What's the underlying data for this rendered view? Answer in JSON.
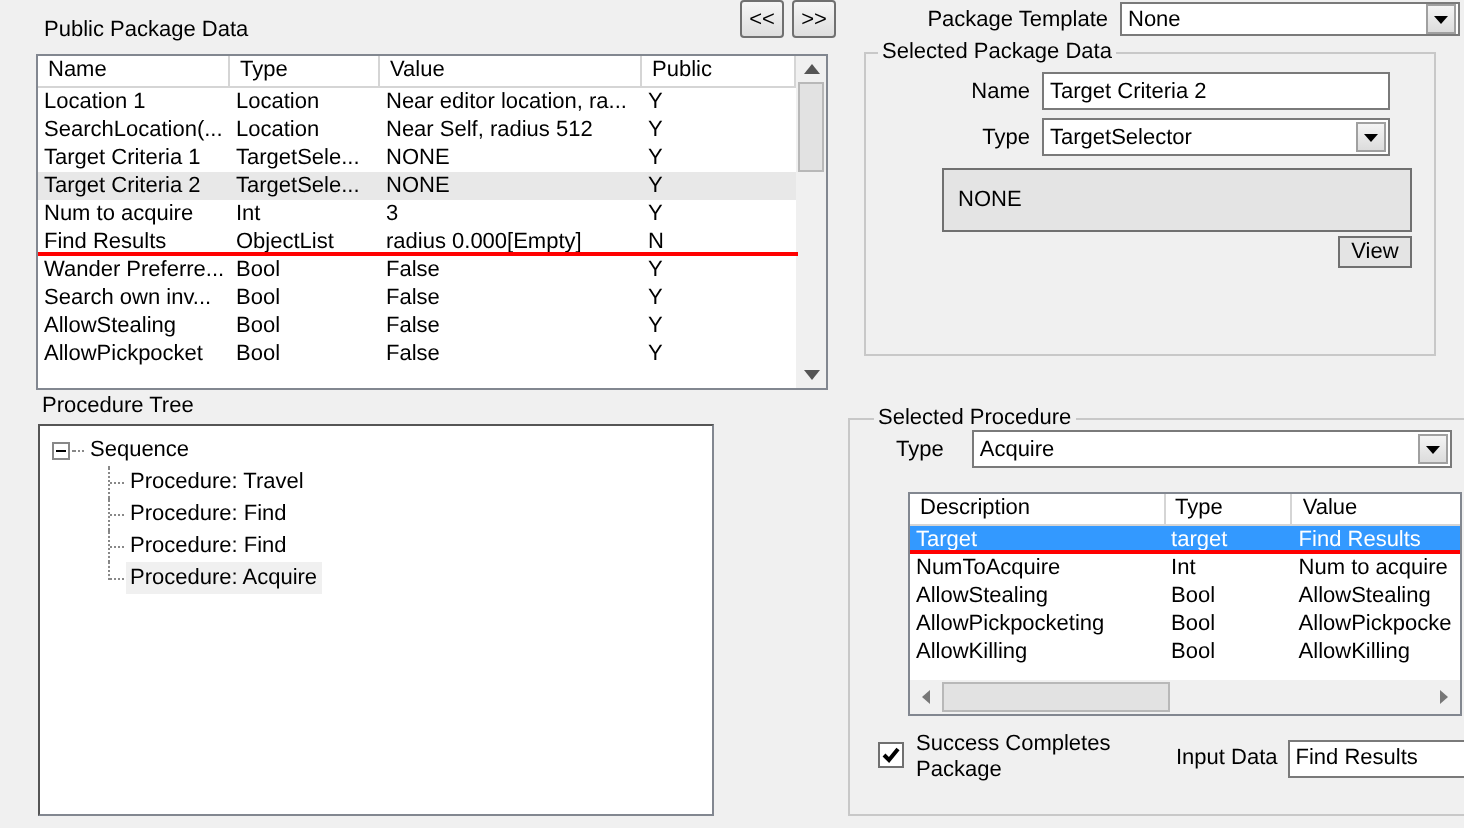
{
  "public_package_data": {
    "title": "Public Package Data",
    "nav_buttons": [
      "<<",
      ">>"
    ],
    "columns": [
      "Name",
      "Type",
      "Value",
      "Public"
    ],
    "rows": [
      {
        "cells": [
          "Location 1",
          "Location",
          "Near editor location, ra...",
          "Y"
        ],
        "selected": false,
        "underlined": false
      },
      {
        "cells": [
          "SearchLocation(...",
          "Location",
          "Near Self, radius 512",
          "Y"
        ],
        "selected": false,
        "underlined": false
      },
      {
        "cells": [
          "Target Criteria 1",
          "TargetSele...",
          "NONE",
          "Y"
        ],
        "selected": false,
        "underlined": false
      },
      {
        "cells": [
          "Target Criteria 2",
          "TargetSele...",
          "NONE",
          "Y"
        ],
        "selected": true,
        "underlined": false
      },
      {
        "cells": [
          "Num to acquire",
          "Int",
          "3",
          "Y"
        ],
        "selected": false,
        "underlined": false
      },
      {
        "cells": [
          "Find Results",
          "ObjectList",
          "radius 0.000[Empty]",
          "N"
        ],
        "selected": false,
        "underlined": true
      },
      {
        "cells": [
          "Wander Preferre...",
          "Bool",
          "False",
          "Y"
        ],
        "selected": false,
        "underlined": false
      },
      {
        "cells": [
          "Search own inv...",
          "Bool",
          "False",
          "Y"
        ],
        "selected": false,
        "underlined": false
      },
      {
        "cells": [
          "AllowStealing",
          "Bool",
          "False",
          "Y"
        ],
        "selected": false,
        "underlined": false
      },
      {
        "cells": [
          "AllowPickpocket",
          "Bool",
          "False",
          "Y"
        ],
        "selected": false,
        "underlined": false
      }
    ]
  },
  "package_template": {
    "label": "Package Template",
    "value": "None"
  },
  "selected_package_data": {
    "title": "Selected Package Data",
    "name_label": "Name",
    "name_value": "Target Criteria 2",
    "type_label": "Type",
    "type_value": "TargetSelector",
    "value_button": "NONE",
    "view_button": "View"
  },
  "procedure_tree": {
    "title": "Procedure Tree",
    "root": {
      "label": "Sequence",
      "expanded": true,
      "selected": false,
      "children": [
        {
          "label": "Procedure: Travel",
          "selected": false
        },
        {
          "label": "Procedure: Find",
          "selected": false
        },
        {
          "label": "Procedure: Find",
          "selected": false
        },
        {
          "label": "Procedure: Acquire",
          "selected": true
        }
      ]
    }
  },
  "selected_procedure": {
    "title": "Selected Procedure",
    "type_label": "Type",
    "type_value": "Acquire",
    "columns": [
      "Description",
      "Type",
      "Value"
    ],
    "rows": [
      {
        "cells": [
          "Target",
          "target",
          "Find Results"
        ],
        "selected": true,
        "underlined": true
      },
      {
        "cells": [
          "NumToAcquire",
          "Int",
          "Num to acquire"
        ],
        "selected": false,
        "underlined": false
      },
      {
        "cells": [
          "AllowStealing",
          "Bool",
          "AllowStealing"
        ],
        "selected": false,
        "underlined": false
      },
      {
        "cells": [
          "AllowPickpocketing",
          "Bool",
          "AllowPickpocke"
        ],
        "selected": false,
        "underlined": false
      },
      {
        "cells": [
          "AllowKilling",
          "Bool",
          "AllowKilling"
        ],
        "selected": false,
        "underlined": false
      }
    ],
    "success_completes": {
      "label": "Success Completes Package",
      "checked": true
    },
    "input_data": {
      "label": "Input Data",
      "value": "Find Results"
    }
  }
}
